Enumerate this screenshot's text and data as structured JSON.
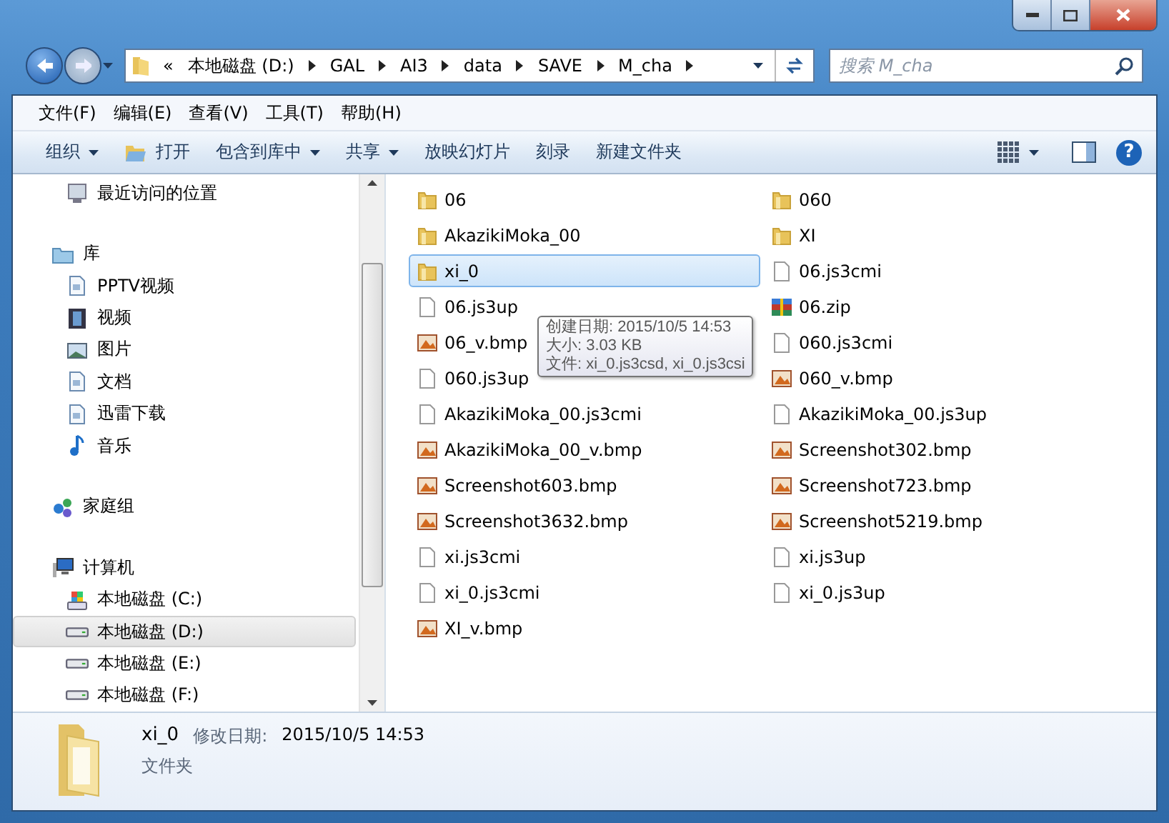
{
  "address_bar": {
    "overflow": "«",
    "crumbs": [
      "本地磁盘 (D:)",
      "GAL",
      "AI3",
      "data",
      "SAVE",
      "M_cha"
    ]
  },
  "search": {
    "placeholder": "搜索 M_cha"
  },
  "menu": [
    "文件(F)",
    "编辑(E)",
    "查看(V)",
    "工具(T)",
    "帮助(H)"
  ],
  "toolbar": [
    {
      "label": "组织",
      "kind": "plain",
      "dropdown": true
    },
    {
      "label": "打开",
      "kind": "open",
      "dropdown": false
    },
    {
      "label": "包含到库中",
      "kind": "plain",
      "dropdown": true
    },
    {
      "label": "共享",
      "kind": "plain",
      "dropdown": true
    },
    {
      "label": "放映幻灯片",
      "kind": "plain",
      "dropdown": false
    },
    {
      "label": "刻录",
      "kind": "plain",
      "dropdown": false
    },
    {
      "label": "新建文件夹",
      "kind": "plain",
      "dropdown": false
    }
  ],
  "help_button": "?",
  "sidebar": {
    "sections": [
      {
        "children": [
          {
            "label": "最近访问的位置",
            "kind": "recent",
            "selected": false
          }
        ]
      },
      {
        "label": "库",
        "kind": "library",
        "selected": false,
        "children": [
          {
            "label": "PPTV视频",
            "kind": "doc",
            "selected": false
          },
          {
            "label": "视频",
            "kind": "video",
            "selected": false
          },
          {
            "label": "图片",
            "kind": "picture",
            "selected": false
          },
          {
            "label": "文档",
            "kind": "doc",
            "selected": false
          },
          {
            "label": "迅雷下载",
            "kind": "doc",
            "selected": false
          },
          {
            "label": "音乐",
            "kind": "music",
            "selected": false
          }
        ]
      },
      {
        "label": "家庭组",
        "kind": "homegroup",
        "selected": false
      },
      {
        "label": "计算机",
        "kind": "computer",
        "selected": false,
        "children": [
          {
            "label": "本地磁盘 (C:)",
            "kind": "sysdrive",
            "selected": false
          },
          {
            "label": "本地磁盘 (D:)",
            "kind": "drive",
            "selected": true
          },
          {
            "label": "本地磁盘 (E:)",
            "kind": "drive",
            "selected": false
          },
          {
            "label": "本地磁盘 (F:)",
            "kind": "drive",
            "selected": false
          }
        ]
      }
    ]
  },
  "files": [
    {
      "name": "06",
      "kind": "folder",
      "selected": false
    },
    {
      "name": "060",
      "kind": "folder",
      "selected": false
    },
    {
      "name": "AkazikiMoka_00",
      "kind": "folder",
      "selected": false
    },
    {
      "name": "XI",
      "kind": "folder",
      "selected": false
    },
    {
      "name": "xi_0",
      "kind": "folder",
      "selected": true
    },
    {
      "name": "06.js3cmi",
      "kind": "file",
      "selected": false
    },
    {
      "name": "06.js3up",
      "kind": "file",
      "selected": false
    },
    {
      "name": "06.zip",
      "kind": "zip",
      "selected": false
    },
    {
      "name": "06_v.bmp",
      "kind": "bmp",
      "selected": false
    },
    {
      "name": "060.js3cmi",
      "kind": "file",
      "selected": false
    },
    {
      "name": "060.js3up",
      "kind": "file",
      "selected": false
    },
    {
      "name": "060_v.bmp",
      "kind": "bmp",
      "selected": false
    },
    {
      "name": "AkazikiMoka_00.js3cmi",
      "kind": "file",
      "selected": false
    },
    {
      "name": "AkazikiMoka_00.js3up",
      "kind": "file",
      "selected": false
    },
    {
      "name": "AkazikiMoka_00_v.bmp",
      "kind": "bmp",
      "selected": false
    },
    {
      "name": "Screenshot302.bmp",
      "kind": "bmp",
      "selected": false
    },
    {
      "name": "Screenshot603.bmp",
      "kind": "bmp",
      "selected": false
    },
    {
      "name": "Screenshot723.bmp",
      "kind": "bmp",
      "selected": false
    },
    {
      "name": "Screenshot3632.bmp",
      "kind": "bmp",
      "selected": false
    },
    {
      "name": "Screenshot5219.bmp",
      "kind": "bmp",
      "selected": false
    },
    {
      "name": "xi.js3cmi",
      "kind": "file",
      "selected": false
    },
    {
      "name": "xi.js3up",
      "kind": "file",
      "selected": false
    },
    {
      "name": "xi_0.js3cmi",
      "kind": "file",
      "selected": false
    },
    {
      "name": "xi_0.js3up",
      "kind": "file",
      "selected": false
    },
    {
      "name": "XI_v.bmp",
      "kind": "bmp",
      "selected": false
    }
  ],
  "tooltip": [
    "创建日期: 2015/10/5 14:53",
    "大小: 3.03 KB",
    "文件: xi_0.js3csd, xi_0.js3csi"
  ],
  "details": {
    "name": "xi_0",
    "modified_label": "修改日期:",
    "modified": "2015/10/5 14:53",
    "type": "文件夹"
  }
}
